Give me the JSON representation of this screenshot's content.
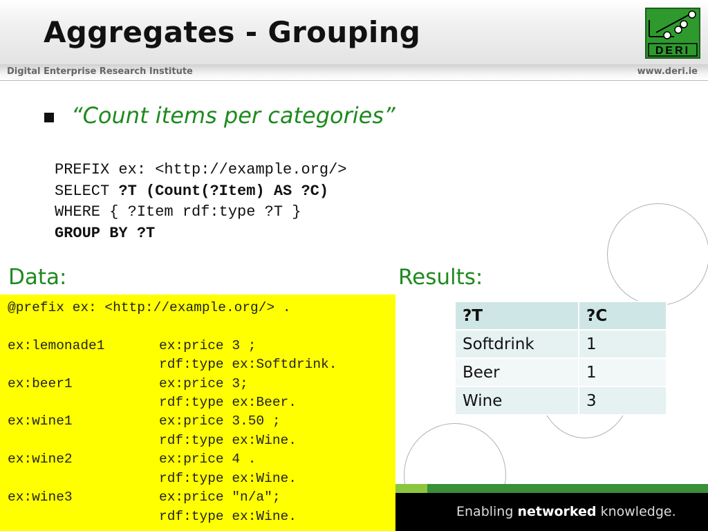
{
  "slide": {
    "title": "Aggregates - Grouping",
    "institute": "Digital Enterprise Research Institute",
    "website": "www.deri.ie",
    "logo_text": "DERI",
    "bullet": "“Count items per categories”"
  },
  "query": {
    "line1": "PREFIX ex: <http://example.org/>",
    "line2_normal": "SELECT ",
    "line2_bold": "?T (Count(?Item) AS ?C)",
    "line3": "WHERE { ?Item rdf:type ?T }",
    "line4": "GROUP BY ?T"
  },
  "data_section": {
    "label": "Data:",
    "prefix_line": "@prefix ex: <http://example.org/> .",
    "rows": [
      {
        "subject": "ex:lemonade1",
        "prop1": "ex:price 3 ;",
        "prop2": "rdf:type ex:Softdrink."
      },
      {
        "subject": "ex:beer1",
        "prop1": "ex:price 3;",
        "prop2": "rdf:type ex:Beer."
      },
      {
        "subject": "ex:wine1",
        "prop1": "ex:price 3.50 ;",
        "prop2": "rdf:type ex:Wine."
      },
      {
        "subject": "ex:wine2",
        "prop1": "ex:price 4 .",
        "prop2": "rdf:type ex:Wine."
      },
      {
        "subject": "ex:wine3",
        "prop1": "ex:price \"n/a\";",
        "prop2": "rdf:type ex:Wine."
      }
    ]
  },
  "results": {
    "label": "Results:",
    "headers": [
      "?T",
      "?C"
    ],
    "rows": [
      [
        "Softdrink",
        "1"
      ],
      [
        "Beer",
        "1"
      ],
      [
        "Wine",
        "3"
      ]
    ]
  },
  "footer": {
    "slogan_before": "Enabling ",
    "slogan_bold": "networked",
    "slogan_after": " knowledge."
  },
  "colors": {
    "accent_green": "#1e8a1e",
    "data_background": "#ffff00",
    "table_header": "#cfe6e6"
  }
}
